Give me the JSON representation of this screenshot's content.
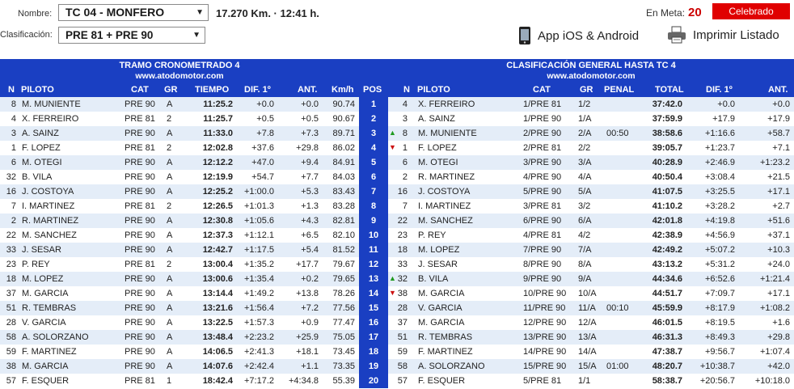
{
  "controls": {
    "nombre_label": "Nombre:",
    "nombre_value": "TC 04 - MONFERO",
    "clasificacion_label": "Clasificación:",
    "clasificacion_value": "PRE 81 + PRE 90",
    "distance_time": "17.270 Km. · 12:41 h.",
    "en_meta_label": "En Meta:",
    "en_meta_value": "20",
    "status_button": "Celebrado",
    "app_link": "App iOS & Android",
    "print_link": "Imprimir Listado"
  },
  "left": {
    "title": "TRAMO CRONOMETRADO 4",
    "subtitle": "www.atodomotor.com",
    "columns": [
      "N",
      "PILOTO",
      "CAT",
      "GR",
      "TIEMPO",
      "DIF. 1º",
      "ANT.",
      "Km/h"
    ],
    "rows": [
      [
        "8",
        "M. MUNIENTE",
        "PRE 90",
        "A",
        "11:25.2",
        "+0.0",
        "+0.0",
        "90.74"
      ],
      [
        "4",
        "X. FERREIRO",
        "PRE 81",
        "2",
        "11:25.7",
        "+0.5",
        "+0.5",
        "90.67"
      ],
      [
        "3",
        "A. SAINZ",
        "PRE 90",
        "A",
        "11:33.0",
        "+7.8",
        "+7.3",
        "89.71"
      ],
      [
        "1",
        "F. LOPEZ",
        "PRE 81",
        "2",
        "12:02.8",
        "+37.6",
        "+29.8",
        "86.02"
      ],
      [
        "6",
        "M. OTEGI",
        "PRE 90",
        "A",
        "12:12.2",
        "+47.0",
        "+9.4",
        "84.91"
      ],
      [
        "32",
        "B. VILA",
        "PRE 90",
        "A",
        "12:19.9",
        "+54.7",
        "+7.7",
        "84.03"
      ],
      [
        "16",
        "J. COSTOYA",
        "PRE 90",
        "A",
        "12:25.2",
        "+1:00.0",
        "+5.3",
        "83.43"
      ],
      [
        "7",
        "I. MARTINEZ",
        "PRE 81",
        "2",
        "12:26.5",
        "+1:01.3",
        "+1.3",
        "83.28"
      ],
      [
        "2",
        "R. MARTINEZ",
        "PRE 90",
        "A",
        "12:30.8",
        "+1:05.6",
        "+4.3",
        "82.81"
      ],
      [
        "22",
        "M. SANCHEZ",
        "PRE 90",
        "A",
        "12:37.3",
        "+1:12.1",
        "+6.5",
        "82.10"
      ],
      [
        "33",
        "J. SESAR",
        "PRE 90",
        "A",
        "12:42.7",
        "+1:17.5",
        "+5.4",
        "81.52"
      ],
      [
        "23",
        "P. REY",
        "PRE 81",
        "2",
        "13:00.4",
        "+1:35.2",
        "+17.7",
        "79.67"
      ],
      [
        "18",
        "M. LOPEZ",
        "PRE 90",
        "A",
        "13:00.6",
        "+1:35.4",
        "+0.2",
        "79.65"
      ],
      [
        "37",
        "M. GARCIA",
        "PRE 90",
        "A",
        "13:14.4",
        "+1:49.2",
        "+13.8",
        "78.26"
      ],
      [
        "51",
        "R. TEMBRAS",
        "PRE 90",
        "A",
        "13:21.6",
        "+1:56.4",
        "+7.2",
        "77.56"
      ],
      [
        "28",
        "V. GARCIA",
        "PRE 90",
        "A",
        "13:22.5",
        "+1:57.3",
        "+0.9",
        "77.47"
      ],
      [
        "58",
        "A. SOLORZANO",
        "PRE 90",
        "A",
        "13:48.4",
        "+2:23.2",
        "+25.9",
        "75.05"
      ],
      [
        "59",
        "F. MARTINEZ",
        "PRE 90",
        "A",
        "14:06.5",
        "+2:41.3",
        "+18.1",
        "73.45"
      ],
      [
        "38",
        "M. GARCIA",
        "PRE 90",
        "A",
        "14:07.6",
        "+2:42.4",
        "+1.1",
        "73.35"
      ],
      [
        "57",
        "F. ESQUER",
        "PRE 81",
        "1",
        "18:42.4",
        "+7:17.2",
        "+4:34.8",
        "55.39"
      ]
    ]
  },
  "pos_header": "POS",
  "positions": [
    "1",
    "2",
    "3",
    "4",
    "5",
    "6",
    "7",
    "8",
    "9",
    "10",
    "11",
    "12",
    "13",
    "14",
    "15",
    "16",
    "17",
    "18",
    "19",
    "20"
  ],
  "right": {
    "title": "CLASIFICACIÓN GENERAL HASTA TC 4",
    "subtitle": "www.atodomotor.com",
    "columns": [
      "N",
      "PILOTO",
      "CAT",
      "GR",
      "PENAL",
      "TOTAL",
      "DIF. 1º",
      "ANT."
    ],
    "rows": [
      [
        "",
        "4",
        "X. FERREIRO",
        "1/PRE 81",
        "1/2",
        "",
        "37:42.0",
        "+0.0",
        "+0.0"
      ],
      [
        "",
        "3",
        "A. SAINZ",
        "1/PRE 90",
        "1/A",
        "",
        "37:59.9",
        "+17.9",
        "+17.9"
      ],
      [
        "up",
        "8",
        "M. MUNIENTE",
        "2/PRE 90",
        "2/A",
        "00:50",
        "38:58.6",
        "+1:16.6",
        "+58.7"
      ],
      [
        "down",
        "1",
        "F. LOPEZ",
        "2/PRE 81",
        "2/2",
        "",
        "39:05.7",
        "+1:23.7",
        "+7.1"
      ],
      [
        "",
        "6",
        "M. OTEGI",
        "3/PRE 90",
        "3/A",
        "",
        "40:28.9",
        "+2:46.9",
        "+1:23.2"
      ],
      [
        "",
        "2",
        "R. MARTINEZ",
        "4/PRE 90",
        "4/A",
        "",
        "40:50.4",
        "+3:08.4",
        "+21.5"
      ],
      [
        "",
        "16",
        "J. COSTOYA",
        "5/PRE 90",
        "5/A",
        "",
        "41:07.5",
        "+3:25.5",
        "+17.1"
      ],
      [
        "",
        "7",
        "I. MARTINEZ",
        "3/PRE 81",
        "3/2",
        "",
        "41:10.2",
        "+3:28.2",
        "+2.7"
      ],
      [
        "",
        "22",
        "M. SANCHEZ",
        "6/PRE 90",
        "6/A",
        "",
        "42:01.8",
        "+4:19.8",
        "+51.6"
      ],
      [
        "",
        "23",
        "P. REY",
        "4/PRE 81",
        "4/2",
        "",
        "42:38.9",
        "+4:56.9",
        "+37.1"
      ],
      [
        "",
        "18",
        "M. LOPEZ",
        "7/PRE 90",
        "7/A",
        "",
        "42:49.2",
        "+5:07.2",
        "+10.3"
      ],
      [
        "",
        "33",
        "J. SESAR",
        "8/PRE 90",
        "8/A",
        "",
        "43:13.2",
        "+5:31.2",
        "+24.0"
      ],
      [
        "up",
        "32",
        "B. VILA",
        "9/PRE 90",
        "9/A",
        "",
        "44:34.6",
        "+6:52.6",
        "+1:21.4"
      ],
      [
        "down",
        "38",
        "M. GARCIA",
        "10/PRE 90",
        "10/A",
        "",
        "44:51.7",
        "+7:09.7",
        "+17.1"
      ],
      [
        "",
        "28",
        "V. GARCIA",
        "11/PRE 90",
        "11/A",
        "00:10",
        "45:59.9",
        "+8:17.9",
        "+1:08.2"
      ],
      [
        "",
        "37",
        "M. GARCIA",
        "12/PRE 90",
        "12/A",
        "",
        "46:01.5",
        "+8:19.5",
        "+1.6"
      ],
      [
        "",
        "51",
        "R. TEMBRAS",
        "13/PRE 90",
        "13/A",
        "",
        "46:31.3",
        "+8:49.3",
        "+29.8"
      ],
      [
        "",
        "59",
        "F. MARTINEZ",
        "14/PRE 90",
        "14/A",
        "",
        "47:38.7",
        "+9:56.7",
        "+1:07.4"
      ],
      [
        "",
        "58",
        "A. SOLORZANO",
        "15/PRE 90",
        "15/A",
        "01:00",
        "48:20.7",
        "+10:38.7",
        "+42.0"
      ],
      [
        "",
        "57",
        "F. ESQUER",
        "5/PRE 81",
        "1/1",
        "",
        "58:38.7",
        "+20:56.7",
        "+10:18.0"
      ]
    ]
  }
}
